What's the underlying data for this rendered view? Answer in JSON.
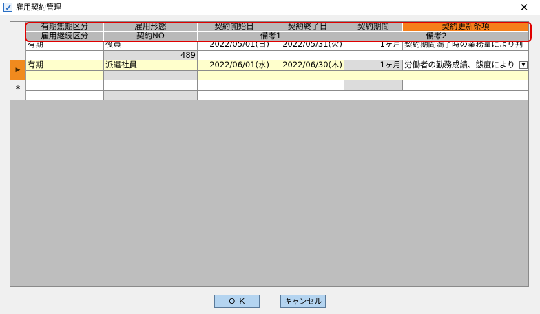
{
  "window": {
    "title": "雇用契約管理",
    "close_glyph": "✕"
  },
  "grid": {
    "header_row1": [
      "有期無期区分",
      "雇用形態",
      "契約開始日",
      "契約終了日",
      "契約期間",
      "契約更新条項"
    ],
    "header_row2": [
      "雇用継続区分",
      "契約NO",
      "備考1",
      "備考2"
    ],
    "rows": [
      {
        "type": "有期",
        "employment": "役員",
        "start": "2022/05/01(日)",
        "end": "2022/05/31(火)",
        "period": "1ヶ月",
        "renewal": "契約期間満了時の業務量により判",
        "continuation": "",
        "contract_no": "489",
        "note1": "",
        "note2": ""
      },
      {
        "type": "有期",
        "employment": "派遣社員",
        "start": "2022/06/01(水)",
        "end": "2022/06/30(木)",
        "period": "1ヶ月",
        "renewal": "労働者の勤務成績、態度により",
        "continuation": "",
        "contract_no": "",
        "note1": "",
        "note2": ""
      }
    ],
    "current_row_marker": "▶",
    "new_row_marker": "*",
    "dropdown_glyph": "▼"
  },
  "buttons": {
    "ok": "Ｏ Ｋ",
    "cancel": "キャンセル"
  },
  "colors": {
    "accent_header": "#f57f1b",
    "highlight_box": "#e00000",
    "selected_row": "#ffffcc",
    "button": "#b4d4f0"
  },
  "icons": {
    "app": "app-window-icon",
    "close": "close-icon",
    "current_row": "row-pointer-icon",
    "new_row": "new-row-icon",
    "dropdown": "chevron-down-icon"
  }
}
